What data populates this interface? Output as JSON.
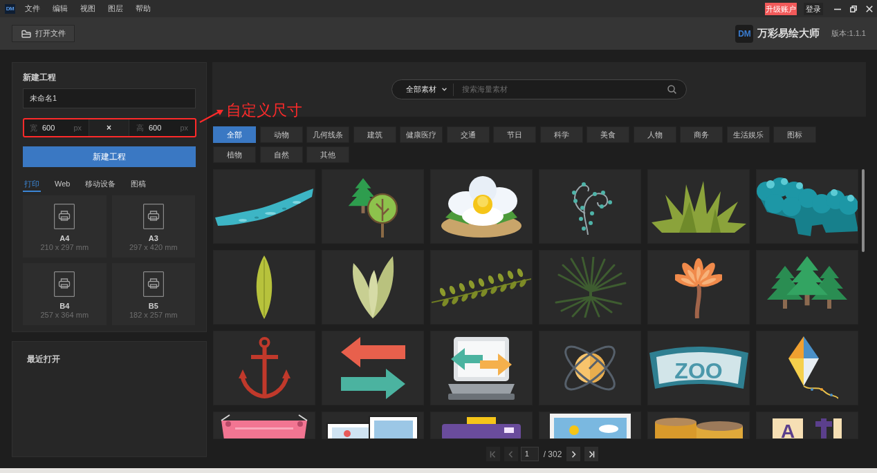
{
  "title_bar": {
    "logo_text": "DM",
    "menu": [
      "文件",
      "编辑",
      "视图",
      "图层",
      "帮助"
    ],
    "upgrade_button": "升级账户",
    "login_button": "登录"
  },
  "toolbar": {
    "open_button": "打开文件",
    "logo_text": "DM",
    "app_name": "万彩易绘大师",
    "version": "版本:1.1.1"
  },
  "new_project": {
    "title": "新建工程",
    "name_field": {
      "value": "未命名1"
    },
    "width_field": {
      "label": "宽",
      "value": "600",
      "unit": "px"
    },
    "separator": "×",
    "height_field": {
      "label": "高",
      "value": "600",
      "unit": "px"
    },
    "create_button": "新建工程",
    "tabs": [
      {
        "label": "打印",
        "selected": true
      },
      {
        "label": "Web",
        "selected": false
      },
      {
        "label": "移动设备",
        "selected": false
      },
      {
        "label": "图稿",
        "selected": false
      }
    ],
    "presets": [
      {
        "name": "A4",
        "size": "210 x 297 mm"
      },
      {
        "name": "A3",
        "size": "297 x 420 mm"
      },
      {
        "name": "B4",
        "size": "257 x 364 mm"
      },
      {
        "name": "B5",
        "size": "182 x 257 mm"
      }
    ]
  },
  "recent": {
    "title": "最近打开"
  },
  "search": {
    "scope": "全部素材",
    "placeholder": "搜索海量素材"
  },
  "categories": [
    {
      "label": "全部",
      "selected": true
    },
    {
      "label": "动物",
      "selected": false
    },
    {
      "label": "几何线条",
      "selected": false
    },
    {
      "label": "建筑",
      "selected": false
    },
    {
      "label": "健康医疗",
      "selected": false
    },
    {
      "label": "交通",
      "selected": false
    },
    {
      "label": "节日",
      "selected": false
    },
    {
      "label": "科学",
      "selected": false
    },
    {
      "label": "美食",
      "selected": false
    },
    {
      "label": "人物",
      "selected": false
    },
    {
      "label": "商务",
      "selected": false
    },
    {
      "label": "生活娱乐",
      "selected": false
    },
    {
      "label": "图标",
      "selected": false
    },
    {
      "label": "植物",
      "selected": false
    },
    {
      "label": "自然",
      "selected": false
    },
    {
      "label": "其他",
      "selected": false
    }
  ],
  "assets": [
    {
      "kind": "ribbon"
    },
    {
      "kind": "trees"
    },
    {
      "kind": "flower"
    },
    {
      "kind": "vine"
    },
    {
      "kind": "grass"
    },
    {
      "kind": "bush"
    },
    {
      "kind": "leaf"
    },
    {
      "kind": "leaves"
    },
    {
      "kind": "branch"
    },
    {
      "kind": "palm"
    },
    {
      "kind": "blossom"
    },
    {
      "kind": "pines"
    },
    {
      "kind": "anchor"
    },
    {
      "kind": "arrows"
    },
    {
      "kind": "laptop"
    },
    {
      "kind": "orbit"
    },
    {
      "kind": "sign",
      "text": "ZOO"
    },
    {
      "kind": "kite"
    },
    {
      "kind": "banner"
    },
    {
      "kind": "photos"
    },
    {
      "kind": "camera"
    },
    {
      "kind": "picture"
    },
    {
      "kind": "cylinders"
    },
    {
      "kind": "letters",
      "text": "A"
    }
  ],
  "pagination": {
    "first": {
      "disabled": true
    },
    "previous": {
      "disabled": true
    },
    "page": "1",
    "total": "/ 302",
    "next": {
      "disabled": false
    },
    "last": {
      "disabled": false
    }
  },
  "annotation": {
    "text": "自定义尺寸"
  }
}
